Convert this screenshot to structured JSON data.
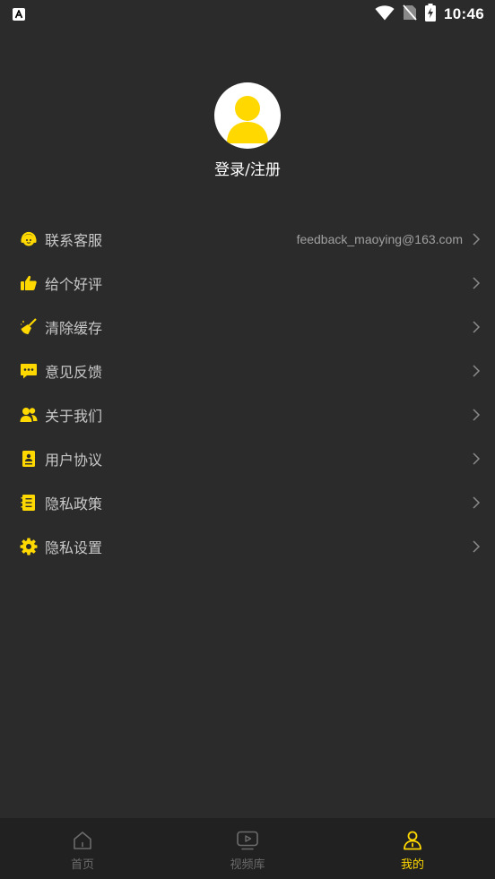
{
  "status_bar": {
    "time": "10:46",
    "icons": [
      "app-a-icon",
      "wifi-icon",
      "no-sim-icon",
      "battery-charging-icon"
    ]
  },
  "profile": {
    "login_label": "登录/注册",
    "avatar_icon": "user-avatar-icon"
  },
  "menu": {
    "items": [
      {
        "label": "联系客服",
        "value": "feedback_maoying@163.com",
        "icon": "headset-icon"
      },
      {
        "label": "给个好评",
        "icon": "thumbs-up-icon"
      },
      {
        "label": "清除缓存",
        "icon": "broom-icon"
      },
      {
        "label": "意见反馈",
        "icon": "chat-bubble-icon"
      },
      {
        "label": "关于我们",
        "icon": "users-icon"
      },
      {
        "label": "用户协议",
        "icon": "agreement-book-icon"
      },
      {
        "label": "隐私政策",
        "icon": "policy-list-icon"
      },
      {
        "label": "隐私设置",
        "icon": "gear-icon"
      }
    ]
  },
  "tab_bar": {
    "tabs": [
      {
        "label": "首页",
        "icon": "home-icon",
        "active": false
      },
      {
        "label": "视频库",
        "icon": "video-library-icon",
        "active": false
      },
      {
        "label": "我的",
        "icon": "profile-icon",
        "active": true
      }
    ]
  },
  "colors": {
    "background": "#2b2b2b",
    "tab_bar_background": "#212121",
    "accent": "#ffd800",
    "label_text": "#c8c8c8",
    "inactive_tab": "#6b6b6b"
  }
}
